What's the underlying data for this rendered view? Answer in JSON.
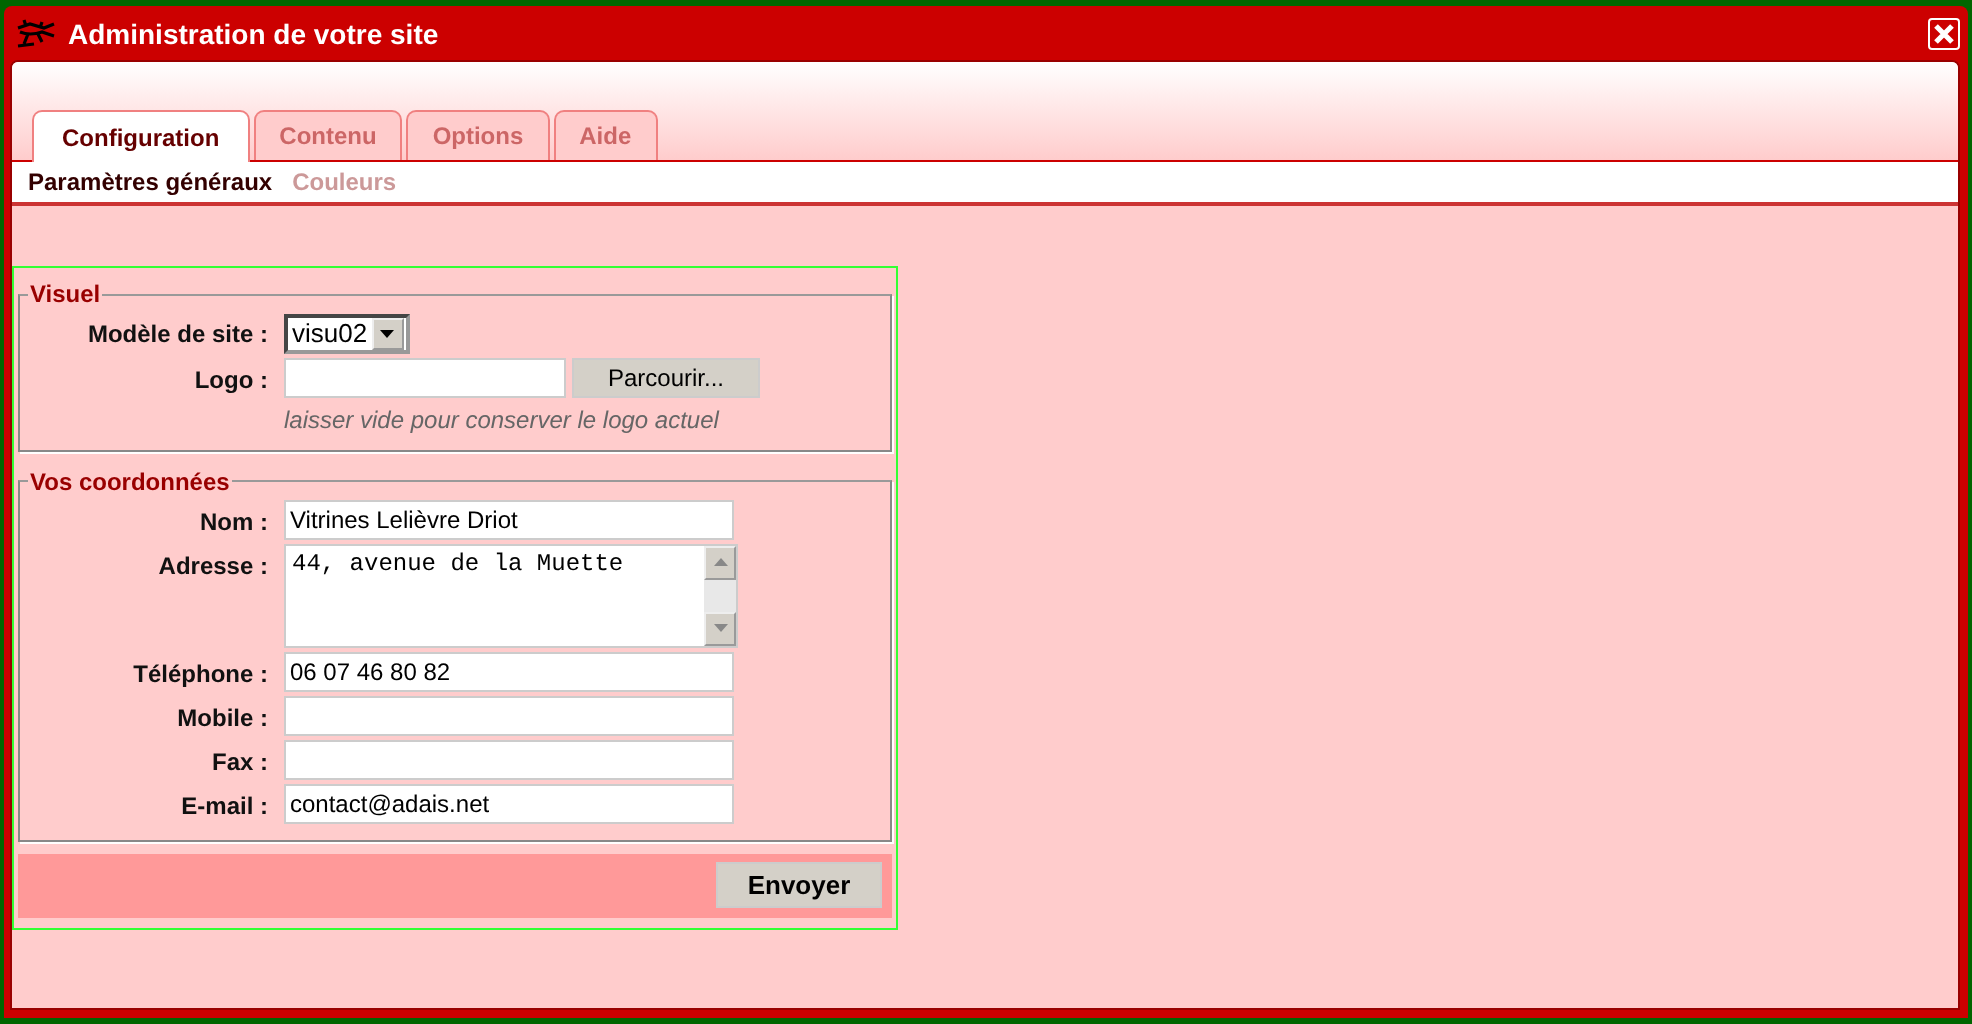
{
  "window": {
    "title": "Administration de votre site"
  },
  "tabs": [
    {
      "label": "Configuration",
      "selected": true
    },
    {
      "label": "Contenu",
      "selected": false
    },
    {
      "label": "Options",
      "selected": false
    },
    {
      "label": "Aide",
      "selected": false
    }
  ],
  "subtabs": [
    {
      "label": "Paramètres généraux",
      "selected": true
    },
    {
      "label": "Couleurs",
      "selected": false
    }
  ],
  "fieldsets": [
    {
      "legend": "Visuel",
      "fields": [
        {
          "kind": "select",
          "label": "Modèle de site :",
          "value": "visu02"
        },
        {
          "kind": "file",
          "label": "Logo :",
          "button": "Parcourir...",
          "hint": "laisser vide pour conserver le logo actuel"
        }
      ]
    },
    {
      "legend": "Vos coordonnées",
      "fields": [
        {
          "kind": "text",
          "label": "Nom :",
          "value": "Vitrines Lelièvre Driot"
        },
        {
          "kind": "textarea",
          "label": "Adresse :",
          "value": "44, avenue de la Muette"
        },
        {
          "kind": "text",
          "label": "Téléphone :",
          "value": "06 07 46 80 82"
        },
        {
          "kind": "text",
          "label": "Mobile :"
        },
        {
          "kind": "text",
          "label": "Fax :"
        },
        {
          "kind": "text",
          "label": "E-mail :",
          "value": "contact@adais.net"
        }
      ]
    }
  ],
  "submit": "Envoyer"
}
